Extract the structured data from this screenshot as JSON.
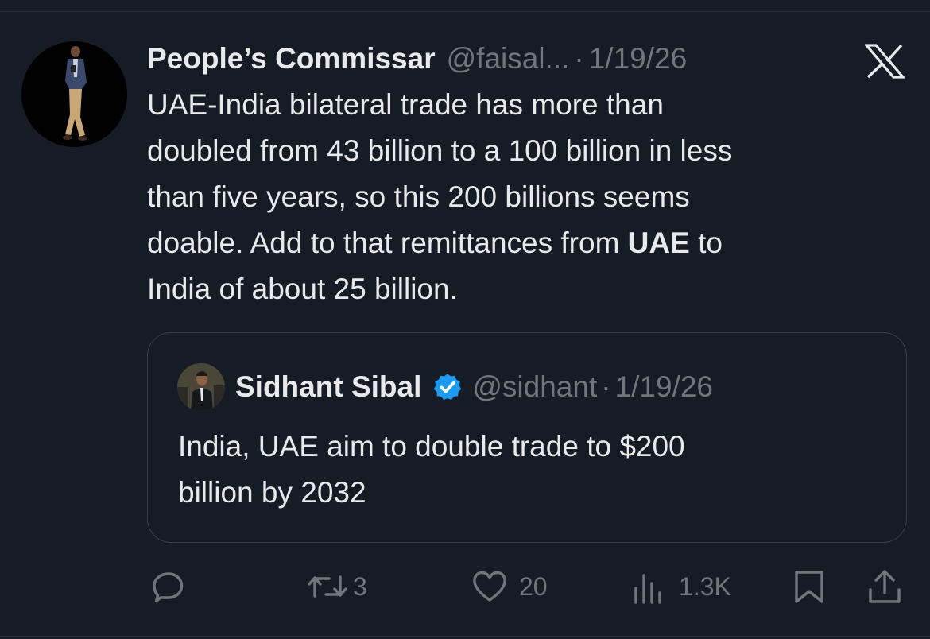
{
  "tweet": {
    "author_name": "People’s Commissar",
    "author_handle": "@faisal...",
    "separator": "·",
    "date": "1/19/26",
    "text_lines": {
      "l1": "UAE-India bilateral trade has more than",
      "l2": "doubled from 43 billion to a 100 billion in less",
      "l3": "than five years, so this 200 billions seems",
      "l4_before": "doable. Add to that remittances from ",
      "l4_bold": "UAE",
      "l4_after": " to",
      "l5": "India of about 25 billion."
    }
  },
  "quoted_tweet": {
    "author_name": "Sidhant Sibal",
    "verified": true,
    "author_handle": "@sidhant",
    "separator": "·",
    "date": "1/19/26",
    "text_lines": {
      "l1": "India, UAE aim to double trade to $200",
      "l2": "billion by 2032"
    }
  },
  "actions": {
    "reply": {
      "icon": "reply-icon"
    },
    "retweet": {
      "icon": "retweet-icon",
      "count": "3"
    },
    "like": {
      "icon": "heart-icon",
      "count": "20"
    },
    "views": {
      "icon": "views-icon",
      "count": "1.3K"
    },
    "bookmark": {
      "icon": "bookmark-icon"
    },
    "share": {
      "icon": "share-icon"
    }
  },
  "brand": {
    "icon": "x-logo-icon"
  },
  "colors": {
    "background": "#161c26",
    "text": "#e7e9ea",
    "muted": "#71767b",
    "verified": "#1d9bf0",
    "border": "#38404c"
  }
}
